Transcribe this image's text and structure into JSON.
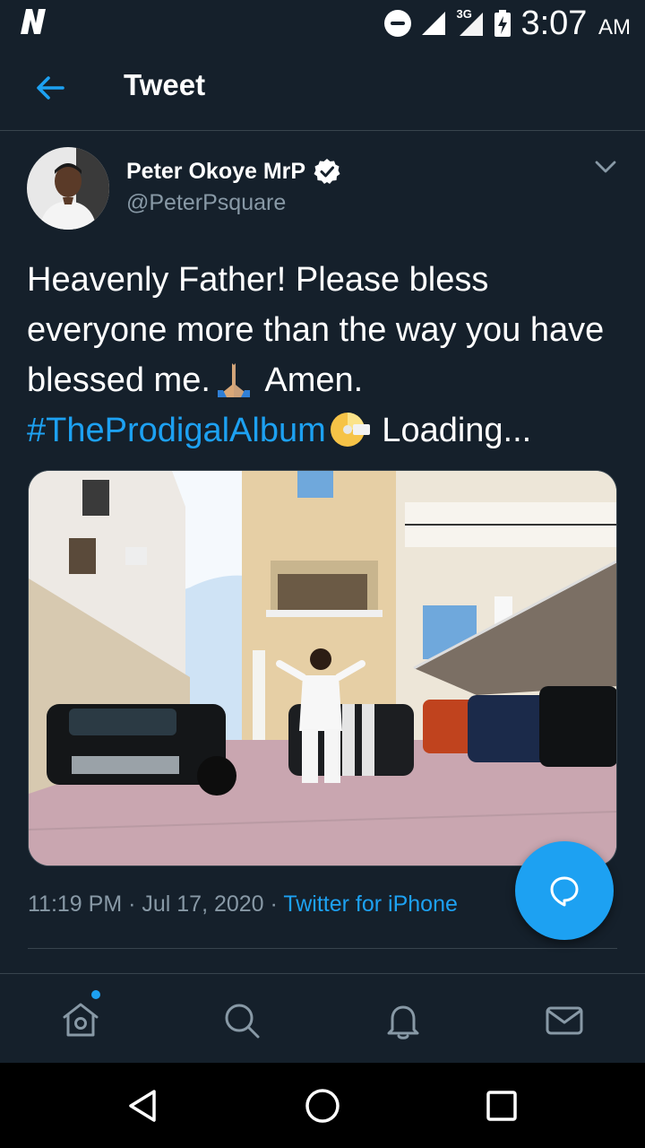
{
  "status_bar": {
    "network_type": "3G",
    "time": "3:07",
    "ampm": "AM",
    "icons": [
      "netflix-n-icon",
      "do-not-disturb-icon",
      "signal-icon",
      "signal-3g-icon",
      "battery-charging-icon"
    ]
  },
  "header": {
    "title": "Tweet",
    "back_icon": "back-arrow-icon"
  },
  "tweet": {
    "author_name": "Peter Okoye MrP",
    "author_handle": "@PeterPsquare",
    "text_part1": "Heavenly Father! Please bless everyone more than the way you have blessed me.",
    "text_part2": " Amen.",
    "hashtag": "#TheProdigalAlbum",
    "text_part3": " Loading...",
    "timestamp": "11:19 PM · Jul 17, 2020 · ",
    "source": "Twitter for iPhone"
  },
  "tab_bar": {
    "items": [
      "home-icon",
      "search-icon",
      "notifications-icon",
      "messages-icon"
    ]
  },
  "nav_bar": {
    "items": [
      "back-triangle-icon",
      "home-circle-icon",
      "recents-square-icon"
    ]
  },
  "colors": {
    "background": "#15202b",
    "accent": "#1da1f2",
    "secondary_text": "#8899a6",
    "divider": "#38444d"
  }
}
